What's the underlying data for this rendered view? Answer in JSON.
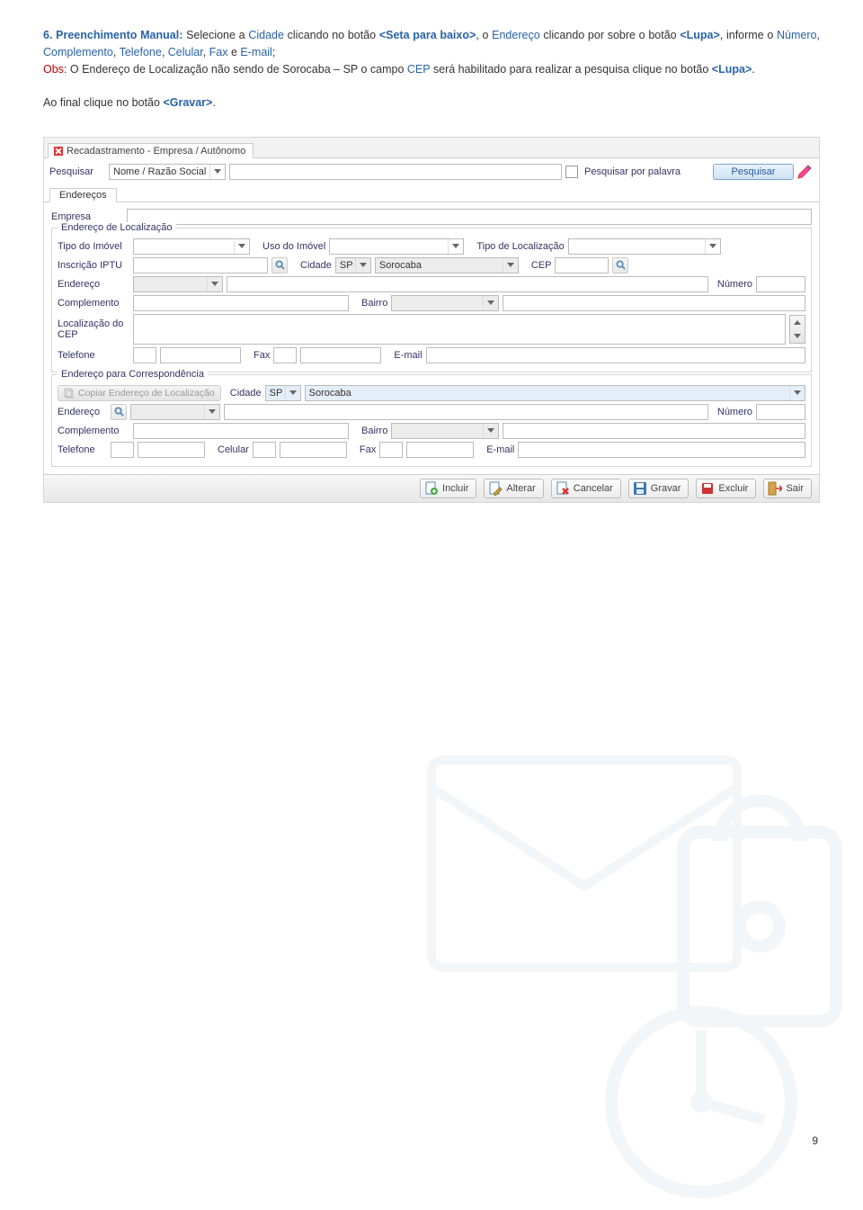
{
  "instruction": {
    "prefix": "6. Preenchimento Manual:",
    "part1_a": " Selecione a ",
    "cidade": "Cidade",
    "part1_b": " clicando no botão ",
    "seta": "<Seta para baixo>",
    "part1_c": ", o ",
    "endereco": "Endereço",
    "part2_a": " clicando por sobre o botão ",
    "lupa": "<Lupa>",
    "part2_b": ", informe o ",
    "numero": "Número",
    "sep": ", ",
    "complemento": "Complemento",
    "telefone": "Telefone",
    "celular": "Celular",
    "fax": "Fax",
    "and_e": " e ",
    "email": "E-mail",
    "semicolon": ";",
    "obs": "Obs:",
    "obs_a": " O Endereço de Localização não sendo de Sorocaba – SP o campo ",
    "cep": "CEP",
    "obs_b": " será habilitado para realizar a pesquisa clique no botão ",
    "lupa2": "<Lupa>",
    "dot": ".",
    "final": "Ao final clique no botão ",
    "gravar": "<Gravar>",
    "finaldot": "."
  },
  "app": {
    "tab_title": "Recadastramento - Empresa / Autônomo",
    "search": {
      "label": "Pesquisar",
      "dropdown": "Nome / Razão Social",
      "por_palavra": "Pesquisar por palavra",
      "button": "Pesquisar"
    },
    "subtab": "Endereços",
    "emp_label": "Empresa",
    "loc": {
      "legend": "Endereço de Localização",
      "tipo_imovel": "Tipo do Imóvel",
      "uso_imovel": "Uso do Imóvel",
      "tipo_loc": "Tipo de Localização",
      "iptu": "Inscrição IPTU",
      "cidade_lbl": "Cidade",
      "cidade_uf": "SP",
      "cidade_nome": "Sorocaba",
      "cep_lbl": "CEP",
      "endereco_lbl": "Endereço",
      "numero_lbl": "Número",
      "complemento_lbl": "Complemento",
      "bairro_lbl": "Bairro",
      "loc_cep_lbl": "Localização do CEP",
      "telefone_lbl": "Telefone",
      "fax_lbl": "Fax",
      "email_lbl": "E-mail"
    },
    "corr": {
      "legend": "Endereço para Correspondência",
      "copiar": "Copiar Endereço de Localização",
      "cidade_lbl": "Cidade",
      "cidade_uf": "SP",
      "cidade_nome": "Sorocaba",
      "endereco_lbl": "Endereço",
      "numero_lbl": "Número",
      "complemento_lbl": "Complemento",
      "bairro_lbl": "Bairro",
      "telefone_lbl": "Telefone",
      "celular_lbl": "Celular",
      "fax_lbl": "Fax",
      "email_lbl": "E-mail"
    },
    "toolbar": {
      "incluir": "Incluir",
      "alterar": "Alterar",
      "cancelar": "Cancelar",
      "gravar": "Gravar",
      "excluir": "Excluir",
      "sair": "Sair"
    }
  },
  "page_number": "9"
}
